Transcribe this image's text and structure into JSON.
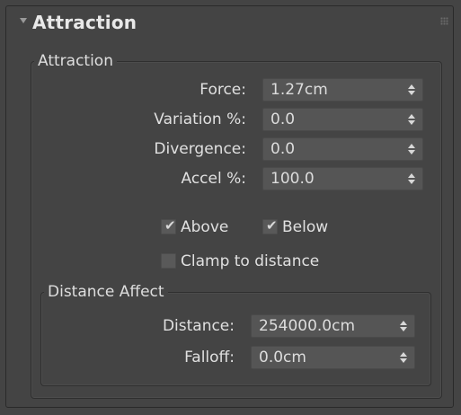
{
  "rollout": {
    "title": "Attraction"
  },
  "attraction_group": {
    "label": "Attraction",
    "force": {
      "label": "Force:",
      "value": "1.27cm"
    },
    "variation": {
      "label": "Variation %:",
      "value": "0.0"
    },
    "divergence": {
      "label": "Divergence:",
      "value": "0.0"
    },
    "accel": {
      "label": "Accel %:",
      "value": "100.0"
    },
    "above": {
      "label": "Above",
      "checked": true
    },
    "below": {
      "label": "Below",
      "checked": true
    },
    "clamp": {
      "label": "Clamp to distance",
      "checked": false
    }
  },
  "distance_group": {
    "label": "Distance Affect",
    "distance": {
      "label": "Distance:",
      "value": "254000.0cm"
    },
    "falloff": {
      "label": "Falloff:",
      "value": "0.0cm"
    }
  },
  "icons": {
    "collapse": "triangle-down-icon",
    "grip": "drag-grip-icon",
    "spinner": "up-down-spinner-icon",
    "check": "checkmark-icon"
  }
}
